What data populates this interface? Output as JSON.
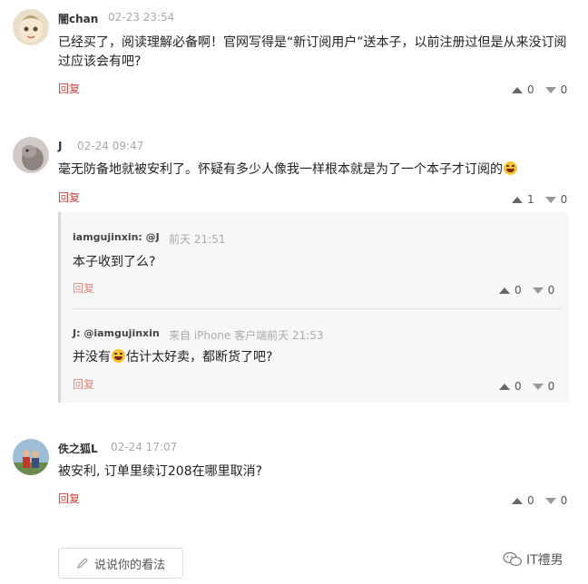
{
  "comments": [
    {
      "user": "闇chan",
      "time": "02-23 23:54",
      "text_lines": [
        "已经买了，阅读理解必备啊！官网写得是“新订阅用户”送本子，以前注册过但是从来没订阅",
        "过应该会有吧?"
      ],
      "reply_label": "回复",
      "up_count": "0",
      "down_count": "0"
    },
    {
      "user": "J",
      "time": "02-24 09:47",
      "text": "毫无防备地就被安利了。怀疑有多少人像我一样根本就是为了一个本子才订阅的",
      "reply_label": "回复",
      "up_count": "1",
      "down_count": "0",
      "sub_replies": [
        {
          "user": "iamgujinxin: @J",
          "time": "前天 21:51",
          "text": "本子收到了么?",
          "reply_label": "回复",
          "up_count": "0",
          "down_count": "0"
        },
        {
          "user": "J: @iamgujinxin",
          "time": "来自 iPhone 客户端前天 21:53",
          "text_before": "并没有",
          "text_after": "估计太好卖，都断货了吧?",
          "reply_label": "回复",
          "up_count": "0",
          "down_count": "0"
        }
      ]
    },
    {
      "user": "佚之狐L",
      "time": "02-24 17:07",
      "text": "被安利, 订单里续订208在哪里取消?",
      "reply_label": "回复",
      "up_count": "0",
      "down_count": "0"
    }
  ],
  "footer": {
    "comment_button_label": "说说你的看法",
    "watermark": "IT禮男"
  }
}
